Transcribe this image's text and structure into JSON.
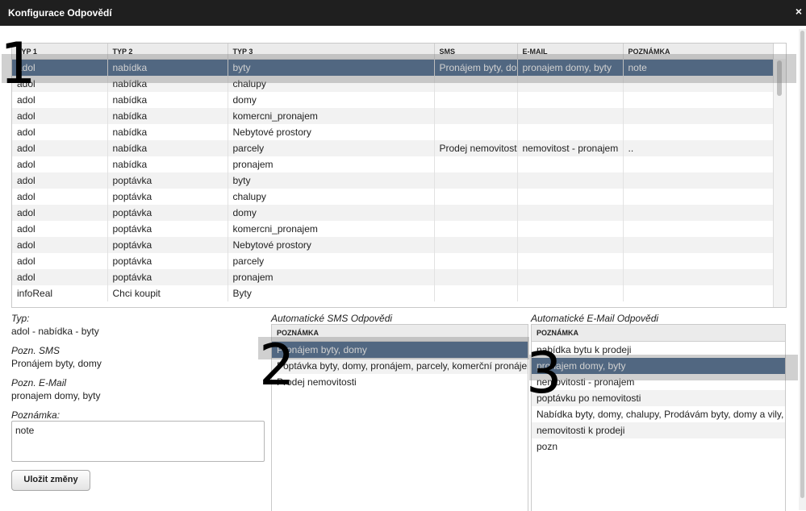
{
  "window": {
    "title": "Konfigurace Odpovědí",
    "close_symbol": "×"
  },
  "grid": {
    "columns": [
      "TYP 1",
      "TYP 2",
      "TYP 3",
      "SMS",
      "E-MAIL",
      "POZNÁMKA"
    ],
    "rows": [
      [
        "adol",
        "nabídka",
        "byty",
        "Pronájem byty, domy",
        "pronajem domy, byty",
        "note"
      ],
      [
        "adol",
        "nabídka",
        "chalupy",
        "",
        "",
        ""
      ],
      [
        "adol",
        "nabídka",
        "domy",
        "",
        "",
        ""
      ],
      [
        "adol",
        "nabídka",
        "komercni_pronajem",
        "",
        "",
        ""
      ],
      [
        "adol",
        "nabídka",
        "Nebytové prostory",
        "",
        "",
        ""
      ],
      [
        "adol",
        "nabídka",
        "parcely",
        "Prodej nemovitosti",
        "nemovitost - pronajem",
        ".."
      ],
      [
        "adol",
        "nabídka",
        "pronajem",
        "",
        "",
        ""
      ],
      [
        "adol",
        "poptávka",
        "byty",
        "",
        "",
        ""
      ],
      [
        "adol",
        "poptávka",
        "chalupy",
        "",
        "",
        ""
      ],
      [
        "adol",
        "poptávka",
        "domy",
        "",
        "",
        ""
      ],
      [
        "adol",
        "poptávka",
        "komercni_pronajem",
        "",
        "",
        ""
      ],
      [
        "adol",
        "poptávka",
        "Nebytové prostory",
        "",
        "",
        ""
      ],
      [
        "adol",
        "poptávka",
        "parcely",
        "",
        "",
        ""
      ],
      [
        "adol",
        "poptávka",
        "pronajem",
        "",
        "",
        ""
      ],
      [
        "infoReal",
        "Chci koupit",
        "Byty",
        "",
        "",
        ""
      ]
    ],
    "selected_row": 0
  },
  "detail": {
    "typ_label": "Typ:",
    "typ_value": "adol - nabídka - byty",
    "sms_label": "Pozn. SMS",
    "sms_value": "Pronájem byty, domy",
    "email_label": "Pozn. E-Mail",
    "email_value": "pronajem domy, byty",
    "note_label": "Poznámka:",
    "note_value": "note",
    "save_label": "Uložit změny"
  },
  "sms_panel": {
    "title": "Automatické SMS Odpovědi",
    "header": "POZNÁMKA",
    "items": [
      "Pronájem byty, domy",
      "Poptávka byty, domy, pronájem, parcely, komerční pronájem",
      "Prodej nemovitosti"
    ],
    "selected": 0
  },
  "email_panel": {
    "title": "Automatické E-Mail Odpovědi",
    "header": "POZNÁMKA",
    "items": [
      "nabídka bytu k prodeji",
      "pronajem domy, byty",
      "nemovitosti - pronajem",
      "poptávku po nemovitosti",
      "Nabídka byty, domy, chalupy, Prodávám byty, domy a vily,",
      "nemovitosti k prodeji",
      "pozn"
    ],
    "selected": 1
  },
  "markers": [
    "1",
    "2",
    "3"
  ],
  "colors": {
    "selection": "#3d5f86",
    "titlebar": "#1f1f1f"
  }
}
